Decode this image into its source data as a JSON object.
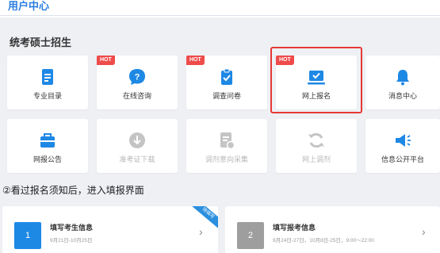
{
  "header": {
    "title": "用户中心"
  },
  "section": {
    "title": "统考硕士招生"
  },
  "tiles": [
    {
      "label": "专业目录",
      "icon": "document-icon",
      "hot": "",
      "enabled": true
    },
    {
      "label": "在线咨询",
      "icon": "chat-help-icon",
      "hot": "HOT",
      "enabled": true
    },
    {
      "label": "调查问卷",
      "icon": "clipboard-icon",
      "hot": "HOT",
      "enabled": true
    },
    {
      "label": "网上报名",
      "icon": "laptop-check-icon",
      "hot": "HOT",
      "enabled": true
    },
    {
      "label": "消息中心",
      "icon": "bell-icon",
      "hot": "",
      "enabled": true
    },
    {
      "label": "网报公告",
      "icon": "bag-icon",
      "hot": "",
      "enabled": true
    },
    {
      "label": "准考证下载",
      "icon": "download-icon",
      "hot": "",
      "enabled": false
    },
    {
      "label": "调剂意向采集",
      "icon": "doc-edit-icon",
      "hot": "",
      "enabled": false
    },
    {
      "label": "网上调剂",
      "icon": "refresh-icon",
      "hot": "",
      "enabled": false
    },
    {
      "label": "信息公开平台",
      "icon": "megaphone-icon",
      "hot": "",
      "enabled": true
    }
  ],
  "notice": "②看过报名须知后，进入填报界面",
  "steps": [
    {
      "num": "1",
      "title": "填写考生信息",
      "sub": "9月21日-10月25日",
      "ribbon": "待填写",
      "color": "#1e88e5"
    },
    {
      "num": "2",
      "title": "填写报考信息",
      "sub": "9月24日-27日，10月8日-25日，9:00～22:00",
      "ribbon": "",
      "color": "#9e9e9e"
    }
  ],
  "colors": {
    "accent": "#2a7ee0",
    "hot": "#ef4b4b",
    "highlight": "#e53935"
  }
}
